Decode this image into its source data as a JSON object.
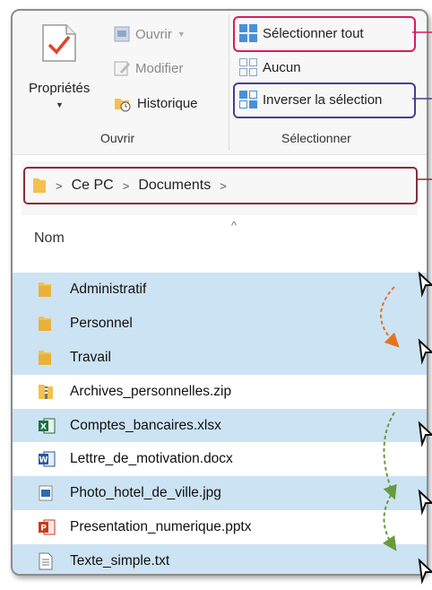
{
  "ribbon": {
    "proprietes": "Propriétés",
    "ouvrir_btn": "Ouvrir",
    "modifier": "Modifier",
    "historique": "Historique",
    "group_ouvrir": "Ouvrir",
    "selectionner_tout": "Sélectionner tout",
    "aucun": "Aucun",
    "inverser": "Inverser la sélection",
    "group_selectionner": "Sélectionner"
  },
  "address": {
    "segments": [
      "Ce PC",
      "Documents"
    ]
  },
  "column": {
    "name": "Nom"
  },
  "files": [
    {
      "name": "Administratif",
      "icon": "folder-icon",
      "selected": true
    },
    {
      "name": "Personnel",
      "icon": "folder-icon",
      "selected": true
    },
    {
      "name": "Travail",
      "icon": "folder-icon",
      "selected": true
    },
    {
      "name": "Archives_personnelles.zip",
      "icon": "zip-folder-icon",
      "selected": false
    },
    {
      "name": "Comptes_bancaires.xlsx",
      "icon": "excel-icon",
      "selected": true
    },
    {
      "name": "Lettre_de_motivation.docx",
      "icon": "word-icon",
      "selected": false
    },
    {
      "name": "Photo_hotel_de_ville.jpg",
      "icon": "image-icon",
      "selected": true
    },
    {
      "name": "Presentation_numerique.pptx",
      "icon": "powerpoint-icon",
      "selected": false
    },
    {
      "name": "Texte_simple.txt",
      "icon": "text-file-icon",
      "selected": true
    }
  ],
  "colors": {
    "select_all_outline": "#d81b60",
    "invert_outline": "#4a3d8f",
    "address_outline": "#8b2c3a",
    "selected_row": "#cce3f3",
    "arrow_orange": "#e8731e",
    "arrow_green": "#6a9a3a"
  }
}
